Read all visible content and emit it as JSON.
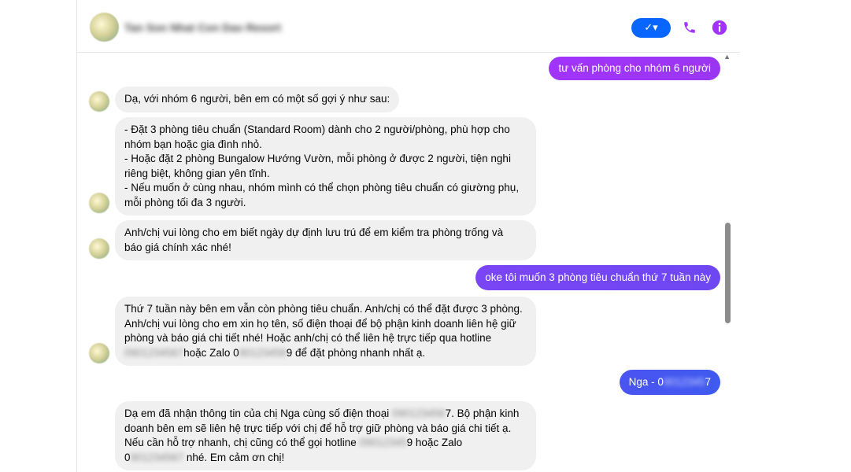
{
  "header": {
    "contact_name": "Tan Son Nhat Con Dao Resort",
    "check_label": "✓▾"
  },
  "colors": {
    "accent": "#0866ff",
    "outgoing_gradient": [
      "#a033ff",
      "#3b5cf6"
    ],
    "icon_purple": "#a033ff"
  },
  "messages": [
    {
      "side": "out",
      "text": "tư vấn phòng cho nhóm 6 người"
    },
    {
      "side": "in",
      "text": "Dạ, với nhóm 6 người, bên em có một số gợi ý như sau:"
    },
    {
      "side": "in",
      "text": "- Đặt 3 phòng tiêu chuẩn (Standard Room) dành cho 2 người/phòng, phù hợp cho\nnhóm bạn hoặc gia đình nhỏ.\n- Hoặc đặt 2 phòng Bungalow Hướng Vườn, mỗi phòng ở được 2 người, tiện nghi\nriêng biệt, không gian yên tĩnh.\n- Nếu muốn ở cùng nhau, nhóm mình có thể chọn phòng tiêu chuẩn có giường phụ,\nmỗi phòng tối đa 3 người."
    },
    {
      "side": "in",
      "text": "Anh/chị vui lòng cho em biết ngày dự định lưu trú để em kiểm tra phòng trống và\nbáo giá chính xác nhé!"
    },
    {
      "side": "out",
      "text": "oke tôi muốn 3 phòng tiêu chuẩn thứ 7 tuần này"
    },
    {
      "side": "in",
      "line1": "Thứ 7 tuần này bên em vẫn còn phòng tiêu chuẩn. Anh/chị có thể đặt được 3 phòng.",
      "line2": "Anh/chị vui lòng cho em xin họ tên, số điện thoại để bộ phận kinh doanh liên hệ giữ",
      "line3": "phòng và báo giá chi tiết nhé! Hoặc anh/chị có thể liên hệ trực tiếp qua hotline",
      "hotline_blur": "0901234567",
      "line4_mid": "hoặc Zalo 0",
      "zalo_blur": "90123456",
      "line4_end": "9 để đặt phòng nhanh nhất ạ."
    },
    {
      "side": "out",
      "prefix": "Nga - 0",
      "phone_blur": "9012345",
      "suffix": "7"
    },
    {
      "side": "in",
      "l1a": "Dạ em đã nhận thông tin của chị Nga cùng số điện thoại ",
      "l1blur": "090123456",
      "l1b": "7. Bộ phận kinh",
      "l2": "doanh bên em sẽ liên hệ trực tiếp với chị để hỗ trợ giữ phòng và báo giá chi tiết ạ.",
      "l3a": "Nếu cần hỗ trợ nhanh, chị cũng có thể gọi hotline ",
      "l3blur": "09012345",
      "l3b": "9 hoặc Zalo",
      "l4a": "0",
      "l4blur": "901234567",
      "l4b": " nhé. Em cảm ơn chị!"
    }
  ]
}
